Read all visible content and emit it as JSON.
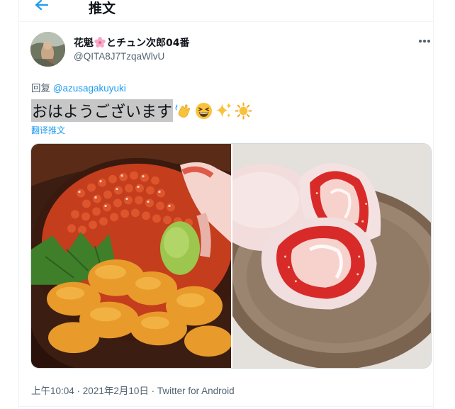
{
  "header": {
    "title": "推文",
    "back_icon": "arrow-left-icon",
    "accent": "#1d9bf0"
  },
  "author": {
    "name_part1": "花魁",
    "name_emoji": "cherry-blossom",
    "name_part2": "とチュン次郎04番",
    "handle": "@QITA8J7TzqaWlvU"
  },
  "tweet": {
    "reply_prefix": "回复 ",
    "reply_to": "@azusagakuyuki",
    "text": "おはようございます",
    "emojis": [
      "waving-hands",
      "grinning-squinting-face",
      "sparkles",
      "sun"
    ],
    "translate_label": "翻译推文"
  },
  "media": [
    {
      "name": "ikura-uni-donburi-photo"
    },
    {
      "name": "strawberry-daifuku-photo"
    }
  ],
  "meta": {
    "time": "上午10:04",
    "date": "2021年2月10日",
    "source": "Twitter for Android",
    "separator": " · "
  }
}
